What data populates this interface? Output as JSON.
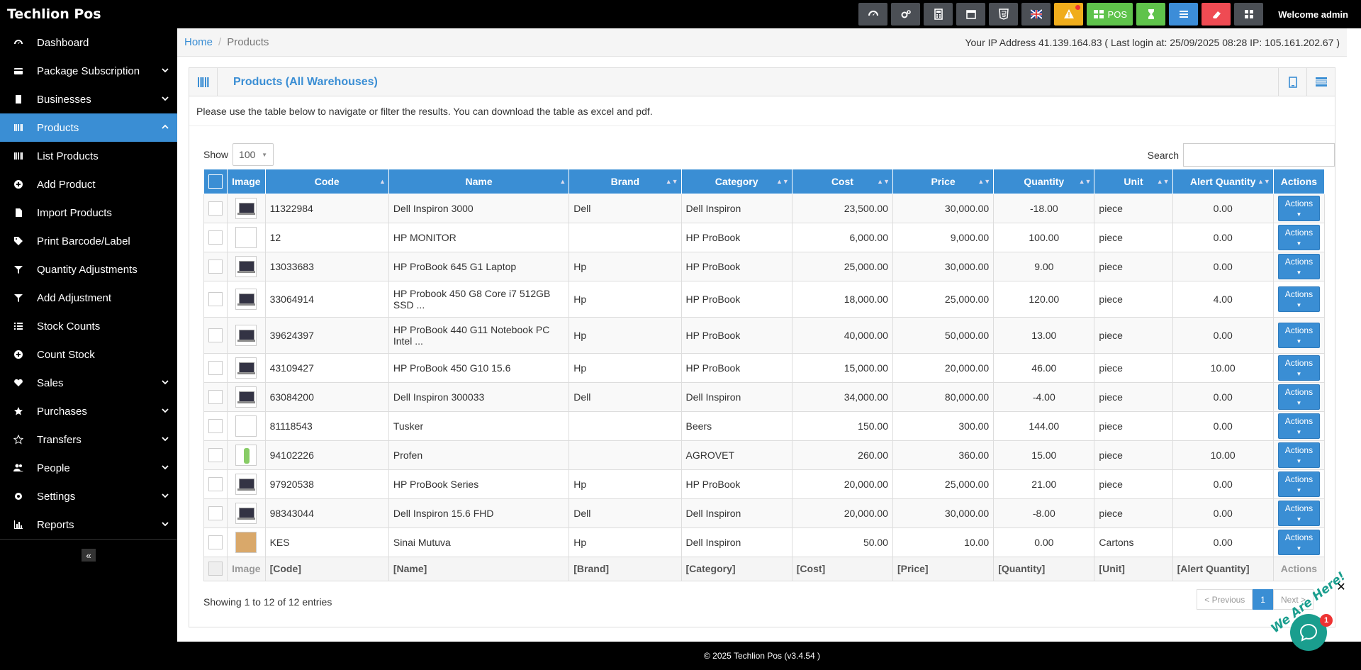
{
  "app": {
    "brand": "Techlion Pos",
    "welcome": "Welcome admin",
    "pos_label": "POS",
    "footer": "© 2025 Techlion Pos (v3.4.54 )"
  },
  "toolbar_icons": [
    "dashboard-icon",
    "cogs-icon",
    "calculator-icon",
    "calendar-icon",
    "html5-icon",
    "flag-uk-icon",
    "warning-icon",
    "pos-icon",
    "hourglass-icon",
    "list-icon",
    "eraser-icon",
    "grid-icon"
  ],
  "sidebar": {
    "items": [
      {
        "label": "Dashboard",
        "icon": "dashboard-icon"
      },
      {
        "label": "Package Subscription",
        "icon": "card-icon"
      },
      {
        "label": "Businesses",
        "icon": "building-icon"
      },
      {
        "label": "Products",
        "icon": "barcode-icon"
      },
      {
        "label": "List Products",
        "icon": "barcode-icon"
      },
      {
        "label": "Add Product",
        "icon": "plus-circle-icon"
      },
      {
        "label": "Import Products",
        "icon": "file-icon"
      },
      {
        "label": "Print Barcode/Label",
        "icon": "tags-icon"
      },
      {
        "label": "Quantity Adjustments",
        "icon": "filter-icon"
      },
      {
        "label": "Add Adjustment",
        "icon": "filter-icon"
      },
      {
        "label": "Stock Counts",
        "icon": "list-ol-icon"
      },
      {
        "label": "Count Stock",
        "icon": "plus-circle-icon"
      },
      {
        "label": "Sales",
        "icon": "heart-icon"
      },
      {
        "label": "Purchases",
        "icon": "star-icon"
      },
      {
        "label": "Transfers",
        "icon": "star-o-icon"
      },
      {
        "label": "People",
        "icon": "users-icon"
      },
      {
        "label": "Settings",
        "icon": "cog-icon"
      },
      {
        "label": "Reports",
        "icon": "bar-chart-icon"
      }
    ],
    "collapse_label": "«"
  },
  "breadcrumb": {
    "home": "Home",
    "current": "Products"
  },
  "ip_info": "Your IP Address 41.139.164.83 ( Last login at: 25/09/2025 08:28 IP: 105.161.202.67 )",
  "panel": {
    "title": "Products (All Warehouses)",
    "intro": "Please use the table below to navigate or filter the results. You can download the table as excel and pdf."
  },
  "controls": {
    "show_label": "Show",
    "show_value": "100",
    "search_label": "Search",
    "search_value": ""
  },
  "table": {
    "headers": [
      "Image",
      "Code",
      "Name",
      "Brand",
      "Category",
      "Cost",
      "Price",
      "Quantity",
      "Unit",
      "Alert Quantity",
      "Actions"
    ],
    "rows": [
      {
        "code": "11322984",
        "name": "Dell Inspiron 3000",
        "brand": "Dell",
        "category": "Dell Inspiron",
        "cost": "23,500.00",
        "price": "30,000.00",
        "qty": "-18.00",
        "unit": "piece",
        "alert": "0.00",
        "img": "laptop-image"
      },
      {
        "code": "12",
        "name": "HP MONITOR",
        "brand": "",
        "category": "HP ProBook",
        "cost": "6,000.00",
        "price": "9,000.00",
        "qty": "100.00",
        "unit": "piece",
        "alert": "0.00",
        "img": "broken-image"
      },
      {
        "code": "13033683",
        "name": "HP ProBook 645 G1 Laptop",
        "brand": "Hp",
        "category": "HP ProBook",
        "cost": "25,000.00",
        "price": "30,000.00",
        "qty": "9.00",
        "unit": "piece",
        "alert": "0.00",
        "img": "laptop-image"
      },
      {
        "code": "33064914",
        "name": "HP Probook 450 G8 Core i7 512GB SSD ...",
        "brand": "Hp",
        "category": "HP ProBook",
        "cost": "18,000.00",
        "price": "25,000.00",
        "qty": "120.00",
        "unit": "piece",
        "alert": "4.00",
        "img": "laptop-image"
      },
      {
        "code": "39624397",
        "name": "HP ProBook 440 G11 Notebook PC Intel ...",
        "brand": "Hp",
        "category": "HP ProBook",
        "cost": "40,000.00",
        "price": "50,000.00",
        "qty": "13.00",
        "unit": "piece",
        "alert": "0.00",
        "img": "laptop-image"
      },
      {
        "code": "43109427",
        "name": "HP ProBook 450 G10 15.6",
        "brand": "Hp",
        "category": "HP ProBook",
        "cost": "15,000.00",
        "price": "20,000.00",
        "qty": "46.00",
        "unit": "piece",
        "alert": "10.00",
        "img": "laptop-image"
      },
      {
        "code": "63084200",
        "name": "Dell Inspiron 300033",
        "brand": "Dell",
        "category": "Dell Inspiron",
        "cost": "34,000.00",
        "price": "80,000.00",
        "qty": "-4.00",
        "unit": "piece",
        "alert": "0.00",
        "img": "laptop-image"
      },
      {
        "code": "81118543",
        "name": "Tusker",
        "brand": "",
        "category": "Beers",
        "cost": "150.00",
        "price": "300.00",
        "qty": "144.00",
        "unit": "piece",
        "alert": "0.00",
        "img": "broken-image"
      },
      {
        "code": "94102226",
        "name": "Profen",
        "brand": "",
        "category": "AGROVET",
        "cost": "260.00",
        "price": "360.00",
        "qty": "15.00",
        "unit": "piece",
        "alert": "10.00",
        "img": "bottle-image"
      },
      {
        "code": "97920538",
        "name": "HP ProBook Series",
        "brand": "Hp",
        "category": "HP ProBook",
        "cost": "20,000.00",
        "price": "25,000.00",
        "qty": "21.00",
        "unit": "piece",
        "alert": "0.00",
        "img": "laptop-image"
      },
      {
        "code": "98343044",
        "name": "Dell Inspiron 15.6 FHD",
        "brand": "Dell",
        "category": "Dell Inspiron",
        "cost": "20,000.00",
        "price": "30,000.00",
        "qty": "-8.00",
        "unit": "piece",
        "alert": "0.00",
        "img": "laptop-image"
      },
      {
        "code": "KES",
        "name": "Sinai Mutuva",
        "brand": "Hp",
        "category": "Dell Inspiron",
        "cost": "50.00",
        "price": "10.00",
        "qty": "0.00",
        "unit": "Cartons",
        "alert": "0.00",
        "img": "box-image"
      }
    ],
    "action_label": "Actions",
    "footer": [
      "Image",
      "[Code]",
      "[Name]",
      "[Brand]",
      "[Category]",
      "[Cost]",
      "[Price]",
      "[Quantity]",
      "[Unit]",
      "[Alert Quantity]",
      "Actions"
    ]
  },
  "pagination": {
    "showing": "Showing 1 to 12 of 12 entries",
    "prev": "< Previous",
    "page": "1",
    "next": "Next >"
  },
  "chat": {
    "badge": "1",
    "tag": "We Are Here!",
    "close": "✕"
  },
  "colors": {
    "accent": "#3a8ed4",
    "topbar": "#000000",
    "warning": "#f0ad1c",
    "success": "#5fc34b",
    "danger": "#ef4b53"
  }
}
